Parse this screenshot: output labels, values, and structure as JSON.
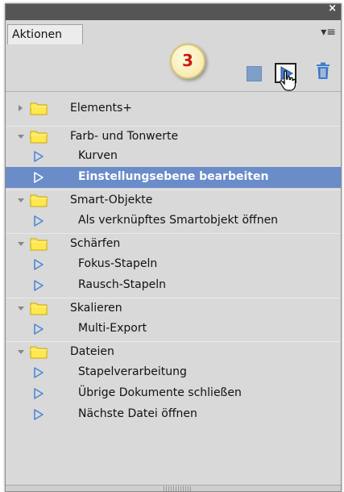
{
  "panel": {
    "tab_label": "Aktionen",
    "close_glyph": "×",
    "menu_glyph": "▾≡",
    "badge_number": "3"
  },
  "items": [
    {
      "type": "folder",
      "label": "Elements+",
      "expanded": false
    },
    {
      "type": "folder",
      "label": "Farb- und Tonwerte",
      "expanded": true
    },
    {
      "type": "action",
      "label": "Kurven"
    },
    {
      "type": "action",
      "label": "Einstellungsebene bearbeiten",
      "selected": true
    },
    {
      "type": "folder",
      "label": "Smart-Objekte",
      "expanded": true
    },
    {
      "type": "action",
      "label": "Als verknüpftes Smartobjekt öffnen"
    },
    {
      "type": "folder",
      "label": "Schärfen",
      "expanded": true
    },
    {
      "type": "action",
      "label": "Fokus-Stapeln"
    },
    {
      "type": "action",
      "label": "Rausch-Stapeln"
    },
    {
      "type": "folder",
      "label": "Skalieren",
      "expanded": true
    },
    {
      "type": "action",
      "label": "Multi-Export"
    },
    {
      "type": "folder",
      "label": "Dateien",
      "expanded": true
    },
    {
      "type": "action",
      "label": "Stapelverarbeitung"
    },
    {
      "type": "action",
      "label": "Übrige Dokumente schließen"
    },
    {
      "type": "action",
      "label": "Nächste Datei öffnen"
    }
  ],
  "colors": {
    "selection": "#6a8cc8",
    "action_icon": "#4f86d8",
    "folder": "#ffe84d",
    "badge_text": "#cc1a10"
  },
  "icons": {
    "stop": "stop-icon",
    "play": "play-icon",
    "trash": "trash-icon",
    "cursor": "hand-cursor-icon"
  }
}
